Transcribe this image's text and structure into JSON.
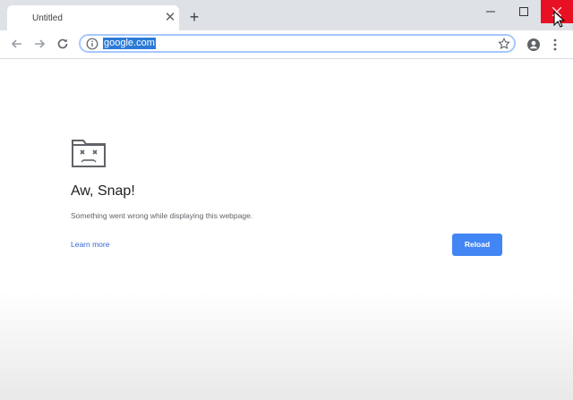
{
  "tabstrip": {
    "tab_title": "Untitled",
    "tab_close_icon": "close-icon",
    "new_tab_icon": "plus-icon"
  },
  "window_controls": {
    "minimize_icon": "minimize-icon",
    "maximize_icon": "maximize-icon",
    "close_icon": "close-icon",
    "close_color": "#e81123"
  },
  "toolbar": {
    "back_icon": "arrow-left-icon",
    "forward_icon": "arrow-right-icon",
    "reload_icon": "reload-icon",
    "omnibox": {
      "info_icon": "info-icon",
      "url": "google.com",
      "star_icon": "star-icon"
    },
    "profile_icon": "account-icon",
    "menu_icon": "more-vert-icon"
  },
  "error_page": {
    "icon": "sad-folder-icon",
    "headline": "Aw, Snap!",
    "message": "Something went wrong while displaying this webpage.",
    "learn_more": "Learn more",
    "reload_button": "Reload",
    "accent_color": "#4285f4"
  }
}
